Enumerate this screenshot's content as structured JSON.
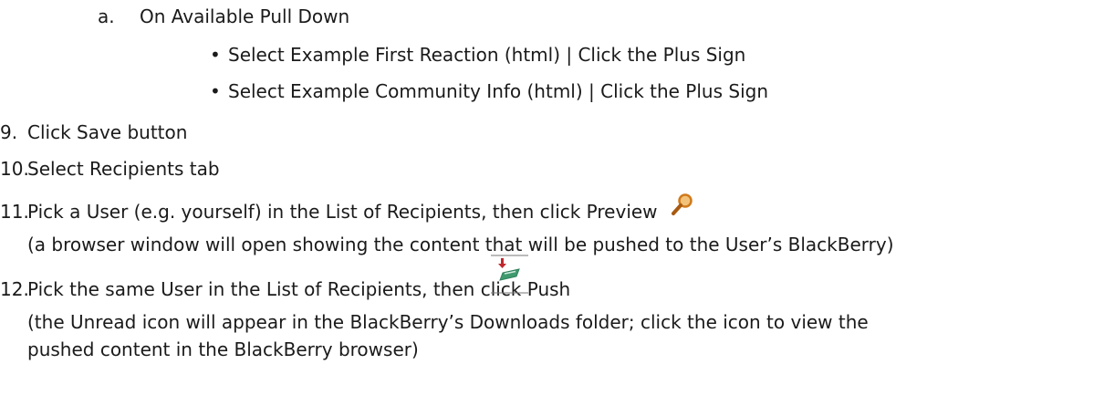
{
  "steps": {
    "a": {
      "marker": "a.",
      "text": "On Available Pull Down"
    },
    "bullets": [
      {
        "text": "Select Example First Reaction (html) | Click the Plus Sign"
      },
      {
        "text": "Select Example Community Info (html) | Click the Plus Sign"
      }
    ],
    "s9": {
      "marker": "9.",
      "text": "Click Save button"
    },
    "s10": {
      "marker": "10.",
      "text": "Select Recipients tab"
    },
    "s11": {
      "marker": "11.",
      "text": "Pick a User (e.g. yourself) in the List of Recipients, then click Preview",
      "icon": "magnifier-icon",
      "note": "(a browser  window will open showing  the content that will be pushed to the User’s BlackBerry)"
    },
    "s12": {
      "marker": "12.",
      "text": "Pick the same User in the List of Recipients, then click Push",
      "icon": "push-icon",
      "note1": "(the Unread icon will appear in the BlackBerry’s Downloads folder; click the icon to view the",
      "note2": "pushed content in the BlackBerry browser)"
    }
  },
  "colors": {
    "text": "#1a1a1a",
    "magnifier": "#d07a1c",
    "push_arrow": "#c0272d",
    "push_tray": "#2f7f5a"
  }
}
